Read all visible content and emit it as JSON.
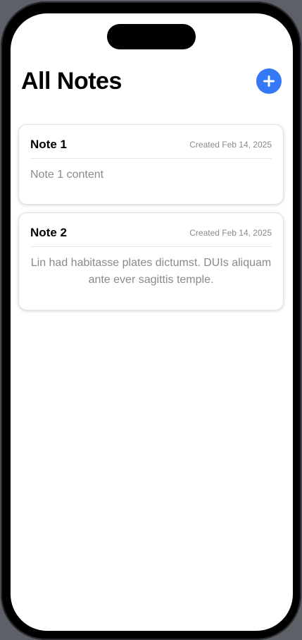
{
  "header": {
    "title": "All Notes",
    "add_icon": "plus-icon",
    "accent_color": "#3478f6"
  },
  "notes": [
    {
      "title": "Note 1",
      "created": "Created Feb 14, 2025",
      "content": "Note 1 content"
    },
    {
      "title": "Note 2",
      "created": "Created Feb 14, 2025",
      "content": "Lin had habitasse plates dictumst. DUIs aliquam ante ever sagittis temple."
    }
  ]
}
